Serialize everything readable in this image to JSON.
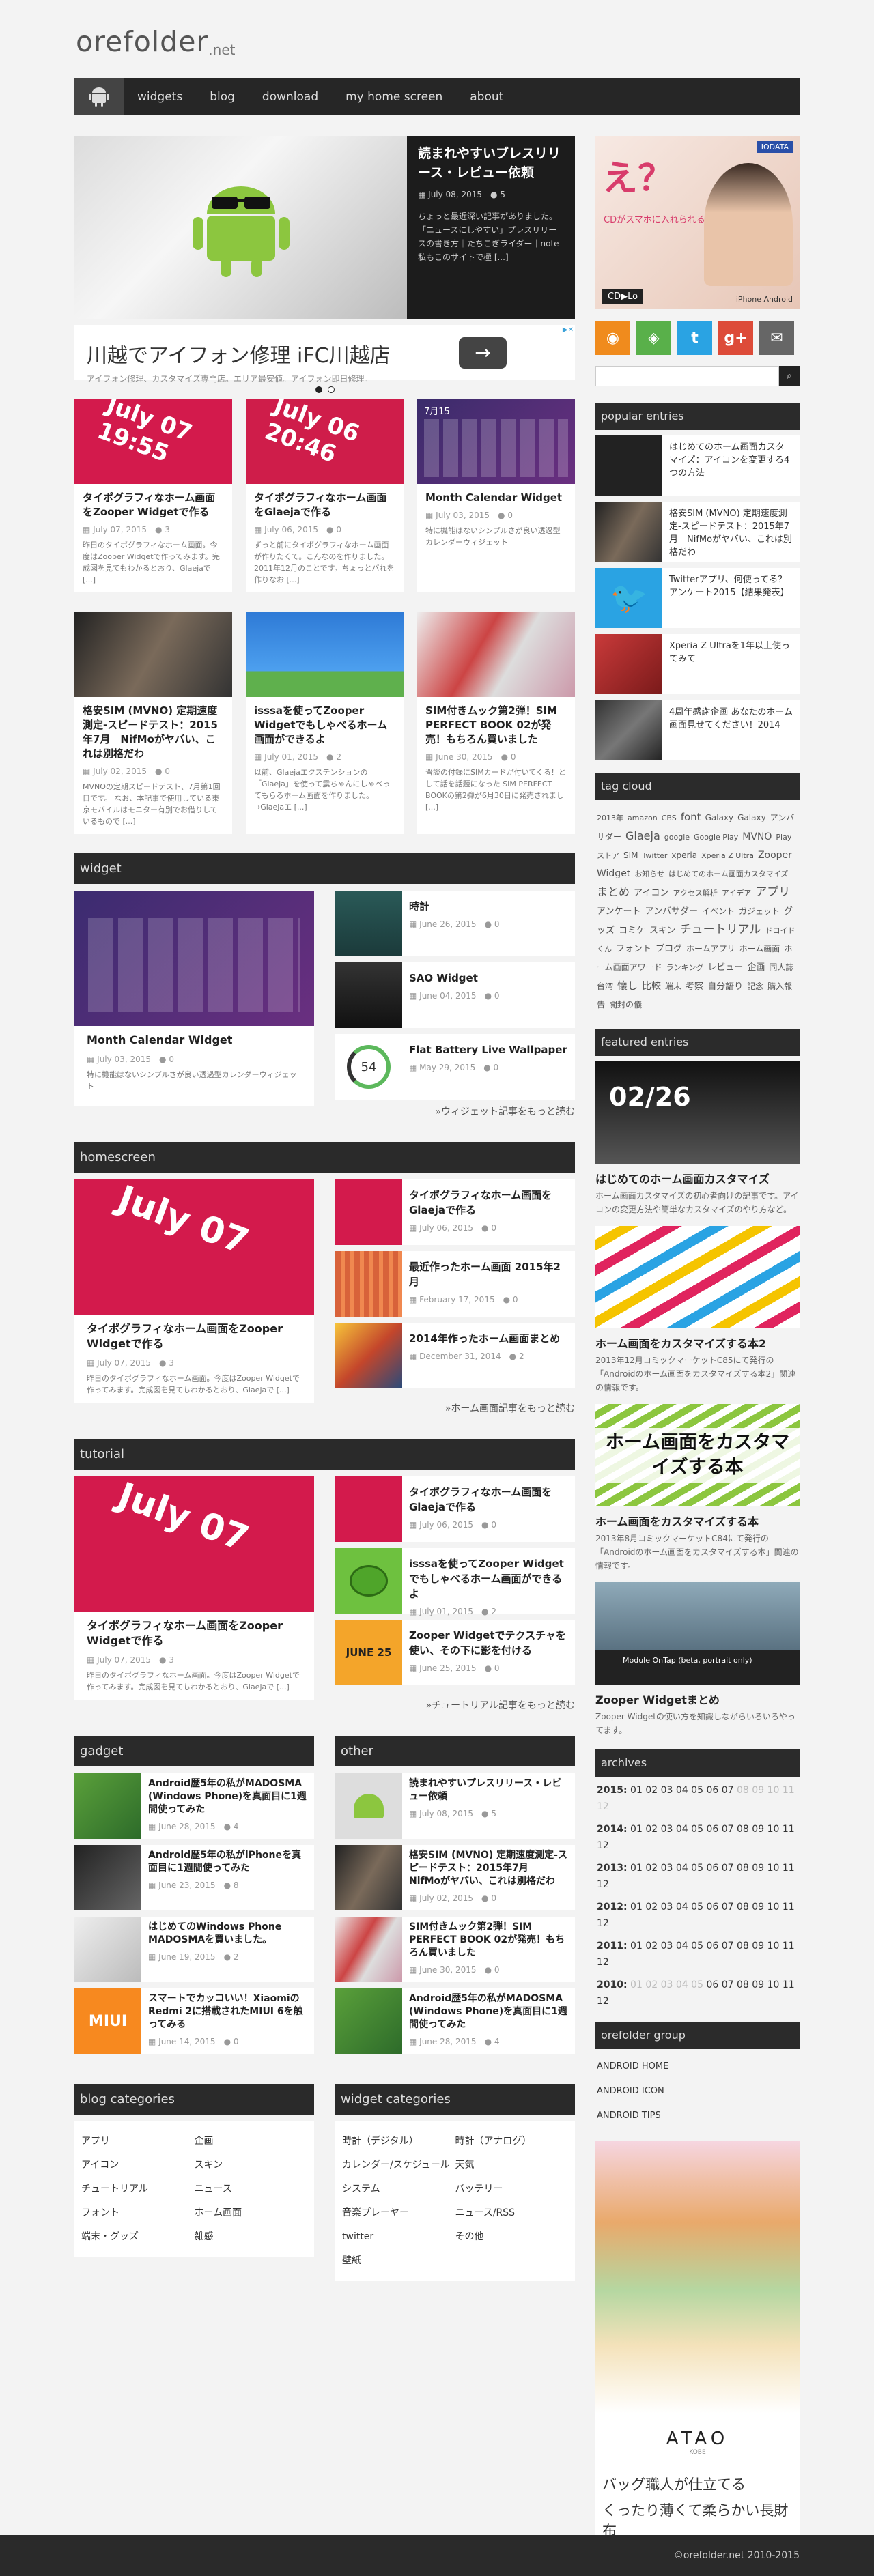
{
  "site": {
    "logo": "orefolder",
    "logo_suffix": ".net"
  },
  "nav": {
    "items": [
      "widgets",
      "blog",
      "download",
      "my home screen",
      "about"
    ]
  },
  "slider": {
    "title": "読まれやすいブレスリリース・レビュー依頼",
    "date": "July 08, 2015",
    "comments": "5",
    "excerpt": "ちょっと最近深い記事がありました。「ニュースにしやすい」プレスリリースの書き方｜たちこぎライダー｜note 私もこのサイトで極 [...]"
  },
  "ad": {
    "headline": "川越でアイフォン修理 iFC川越店",
    "sub": "アイフォン修理、カスタマイズ専門店。エリア最安値。アイフォン即日修理。"
  },
  "cards": [
    {
      "title": "タイポグラフィなホーム画面をZooper Widgetで作る",
      "date": "July 07, 2015",
      "comments": "3",
      "excerpt": "昨日のタイポグラフィなホーム画面。今度はZooper Widgetで作ってみます。完成図を見てもわかるとおり、Glaejaで [...]",
      "thumb": "July 07 19:55"
    },
    {
      "title": "タイポグラフィなホーム画面をGlaejaで作る",
      "date": "July 06, 2015",
      "comments": "0",
      "excerpt": "ずっと前にタイポグラフィなホーム画面が作りたくて。こんなのを作りました。2011年12月のことです。ちょっとバれを作りなお [...]",
      "thumb": "July 06 20:46"
    },
    {
      "title": "Month Calendar Widget",
      "date": "July 03, 2015",
      "comments": "0",
      "excerpt": "特に機能はないシンプルさが良い透過型カレンダーウィジェット",
      "thumb": "7月15"
    },
    {
      "title": "格安SIM (MVNO) 定期速度測定-スピードテスト：2015年7月　NifMoがヤバい、これは別格だわ",
      "date": "July 02, 2015",
      "comments": "0",
      "excerpt": "MVNOの定期スピードテスト、7月第1回目です。 なお、本記事で使用している東京モバイルはモニター有別でお借りしているもので [...]",
      "thumb": ""
    },
    {
      "title": "isssaを使ってZooper Widgetでもしゃべるホーム画面ができるよ",
      "date": "July 01, 2015",
      "comments": "2",
      "excerpt": "以前、Glaejaエクステンションの「Glaeja」を使って震ちゃんにしゃべってもらるホーム画面を作りました。→Glaejaエ [...]",
      "thumb": ""
    },
    {
      "title": "SIM付きムック第2弾！SIM PERFECT BOOK 02が発売！もちろん買いました",
      "date": "June 30, 2015",
      "comments": "0",
      "excerpt": "晋談の付録にSIMカードが付いてくる！として話を話題になった SIM PERFECT BOOKの第2弾が6月30日に発売されまし [...]",
      "thumb": ""
    }
  ],
  "widget_sec": {
    "title": "widget",
    "big": {
      "title": "Month Calendar Widget",
      "date": "July 03, 2015",
      "comments": "0",
      "excerpt": "特に機能はないシンプルさが良い透過型カレンダーウィジェット"
    },
    "list": [
      {
        "title": "時計",
        "date": "June 26, 2015",
        "comments": "0"
      },
      {
        "title": "SAO Widget",
        "date": "June 04, 2015",
        "comments": "0"
      },
      {
        "title": "Flat Battery Live Wallpaper",
        "date": "May 29, 2015",
        "comments": "0",
        "badge": "54"
      }
    ],
    "more": "»ウィジェット記事をもっと読む"
  },
  "home_sec": {
    "title": "homescreen",
    "big": {
      "title": "タイポグラフィなホーム画面をZooper Widgetで作る",
      "date": "July 07, 2015",
      "comments": "3",
      "excerpt": "昨日のタイポグラフィなホーム画面。今度はZooper Widgetで作ってみます。完成図を見てもわかるとおり、Glaejaで [...]"
    },
    "list": [
      {
        "title": "タイポグラフィなホーム画面をGlaejaで作る",
        "date": "July 06, 2015",
        "comments": "0"
      },
      {
        "title": "最近作ったホーム画面 2015年2月",
        "date": "February 17, 2015",
        "comments": "0"
      },
      {
        "title": "2014年作ったホーム画面まとめ",
        "date": "December 31, 2014",
        "comments": "2"
      }
    ],
    "more": "»ホーム画面記事をもっと読む"
  },
  "tut_sec": {
    "title": "tutorial",
    "big": {
      "title": "タイポグラフィなホーム画面をZooper Widgetで作る",
      "date": "July 07, 2015",
      "comments": "3",
      "excerpt": "昨日のタイポグラフィなホーム画面。今度はZooper Widgetで作ってみます。完成図を見てもわかるとおり、Glaejaで [...]"
    },
    "list": [
      {
        "title": "タイポグラフィなホーム画面をGlaejaで作る",
        "date": "July 06, 2015",
        "comments": "0"
      },
      {
        "title": "isssaを使ってZooper Widgetでもしゃべるホーム画面ができるよ",
        "date": "July 01, 2015",
        "comments": "2"
      },
      {
        "title": "Zooper Widgetでテクスチャを使い、その下に影を付ける",
        "date": "June 25, 2015",
        "comments": "0",
        "badge": "JUNE 25"
      }
    ],
    "more": "»チュートリアル記事をもっと読む"
  },
  "gadget": {
    "title": "gadget",
    "list": [
      {
        "title": "Android歴5年の私がMADOSMA (Windows Phone)を真面目に1週間使ってみた",
        "date": "June 28, 2015",
        "comments": "4"
      },
      {
        "title": "Android歴5年の私がiPhoneを真面目に1週間使ってみた",
        "date": "June 23, 2015",
        "comments": "8"
      },
      {
        "title": "はじめてのWindows Phone MADOSMAを買いました。",
        "date": "June 19, 2015",
        "comments": "2"
      },
      {
        "title": "スマートでカッコいい！XiaomiのRedmi 2に搭載されたMIUI 6を触ってみる",
        "date": "June 14, 2015",
        "comments": "0",
        "badge": "MIUI"
      }
    ]
  },
  "other": {
    "title": "other",
    "list": [
      {
        "title": "読まれやすいプレスリリース・レビュー依頼",
        "date": "July 08, 2015",
        "comments": "5"
      },
      {
        "title": "格安SIM (MVNO) 定期速度測定-スピードテスト：2015年7月　NifMoがヤバい、これは別格だわ",
        "date": "July 02, 2015",
        "comments": "0"
      },
      {
        "title": "SIM付きムック第2弾！SIM PERFECT BOOK 02が発売！もちろん買いました",
        "date": "June 30, 2015",
        "comments": "0"
      },
      {
        "title": "Android歴5年の私がMADOSMA (Windows Phone)を真面目に1週間使ってみた",
        "date": "June 28, 2015",
        "comments": "4"
      }
    ]
  },
  "blogcats": {
    "title": "blog categories",
    "items": [
      "アプリ",
      "企画",
      "アイコン",
      "スキン",
      "チュートリアル",
      "ニュース",
      "フォント",
      "ホーム画面",
      "端末・グッズ",
      "雑感"
    ]
  },
  "widgetcats": {
    "title": "widget categories",
    "items": [
      "時計（デジタル）",
      "時計（アナログ）",
      "カレンダー/スケジュール",
      "天気",
      "システム",
      "バッテリー",
      "音楽プレーヤー",
      "ニュース/RSS",
      "twitter",
      "その他",
      "壁紙"
    ]
  },
  "side": {
    "ad": {
      "headline": "え？",
      "caption": "CDがスマホに入れられるの？",
      "brand": "IODATA",
      "brand2": "CD▶Lo",
      "brand3": "iPhone Android"
    },
    "popular": {
      "title": "popular entries",
      "items": [
        "はじめてのホーム画面カスタマイズ：アイコンを変更する4つの方法",
        "格安SIM (MVNO) 定期速度測定-スピードテスト：2015年7月　NifMoがヤバい、これは別格だわ",
        "Twitterアプリ、何使ってる？アンケート2015【結果発表】",
        "Xperia Z Ultraを1年以上使ってみて",
        "4周年感謝企画 あなたのホーム画面見せてください！2014"
      ]
    },
    "tagcloud": {
      "title": "tag cloud",
      "tags": [
        "2013年",
        "amazon",
        "CBS",
        "font",
        "Galaxy",
        "Galaxy",
        "アンバサダー",
        "Glaeja",
        "google",
        "Google Play",
        "MVNO",
        "Play ストア",
        "SIM",
        "Twitter",
        "xperia",
        "Xperia Z Ultra",
        "Zooper Widget",
        "お知らせ",
        "はじめてのホーム画面カスタマイズ",
        "まとめ",
        "アイコン",
        "アクセス解析",
        "アイデア",
        "アプリ",
        "アンケート",
        "アンバサダー",
        "イベント",
        "ガジェット",
        "グッズ",
        "コミケ",
        "スキン",
        "チュートリアル",
        "ドロイドくん",
        "フォント",
        "ブログ",
        "ホームアプリ",
        "ホーム画面",
        "ホーム画面アワード",
        "ランキング",
        "レビュー",
        "企画",
        "同人誌",
        "台湾",
        "懐し",
        "比較",
        "端末",
        "考察",
        "自分語り",
        "記念",
        "購入報告",
        "開封の儀"
      ]
    },
    "featured": {
      "title": "featured entries",
      "items": [
        {
          "title": "はじめてのホーム画面カスタマイズ",
          "text": "ホーム画面カスタマイズの初心者向けの記事です。アイコンの変更方法や簡単なカスタマイズのやり方など。",
          "thumb": "02/26"
        },
        {
          "title": "ホーム画面をカスタマイズする本2",
          "text": "2013年12月コミックマーケットC85にて発行の「Androidのホーム画面をカスタマイズする本2」関連の情報です。",
          "thumb": ""
        },
        {
          "title": "ホーム画面をカスタマイズする本",
          "text": "2013年8月コミックマーケットC84にて発行の「Androidのホーム画面をカスタマイズする本」関連の情報です。",
          "thumb": "ホーム画面をカスタマイズする本"
        },
        {
          "title": "Zooper Widgetまとめ",
          "text": "Zooper Widgetの使い方を知識しながらいろいろやってます。",
          "thumb": "Module OnTap (beta, portrait only)"
        }
      ]
    },
    "archives": {
      "title": "archives",
      "rows": [
        {
          "year": "2015:",
          "months": [
            "01",
            "02",
            "03",
            "04",
            "05",
            "06",
            "07",
            "08",
            "09",
            "10",
            "11",
            "12"
          ],
          "active": 7
        },
        {
          "year": "2014:",
          "months": [
            "01",
            "02",
            "03",
            "04",
            "05",
            "06",
            "07",
            "08",
            "09",
            "10",
            "11",
            "12"
          ],
          "active": 12
        },
        {
          "year": "2013:",
          "months": [
            "01",
            "02",
            "03",
            "04",
            "05",
            "06",
            "07",
            "08",
            "09",
            "10",
            "11",
            "12"
          ],
          "active": 12
        },
        {
          "year": "2012:",
          "months": [
            "01",
            "02",
            "03",
            "04",
            "05",
            "06",
            "07",
            "08",
            "09",
            "10",
            "11",
            "12"
          ],
          "active": 12
        },
        {
          "year": "2011:",
          "months": [
            "01",
            "02",
            "03",
            "04",
            "05",
            "06",
            "07",
            "08",
            "09",
            "10",
            "11",
            "12"
          ],
          "active": 12
        },
        {
          "year": "2010:",
          "months": [
            "01",
            "02",
            "03",
            "04",
            "05",
            "06",
            "07",
            "08",
            "09",
            "10",
            "11",
            "12"
          ],
          "active": 12,
          "startDim": 6
        }
      ]
    },
    "group": {
      "title": "orefolder group",
      "items": [
        "ANDROID HOME",
        "ANDROID ICON",
        "ANDROID TIPS"
      ]
    },
    "ad2": {
      "logo": "ATAO",
      "logo_sub": "KOBE",
      "line1": "バッグ職人が仕立てる",
      "line2": "くったり薄くて柔らかい長財布"
    }
  },
  "footer": {
    "copy": "©orefolder.net 2010-2015"
  }
}
